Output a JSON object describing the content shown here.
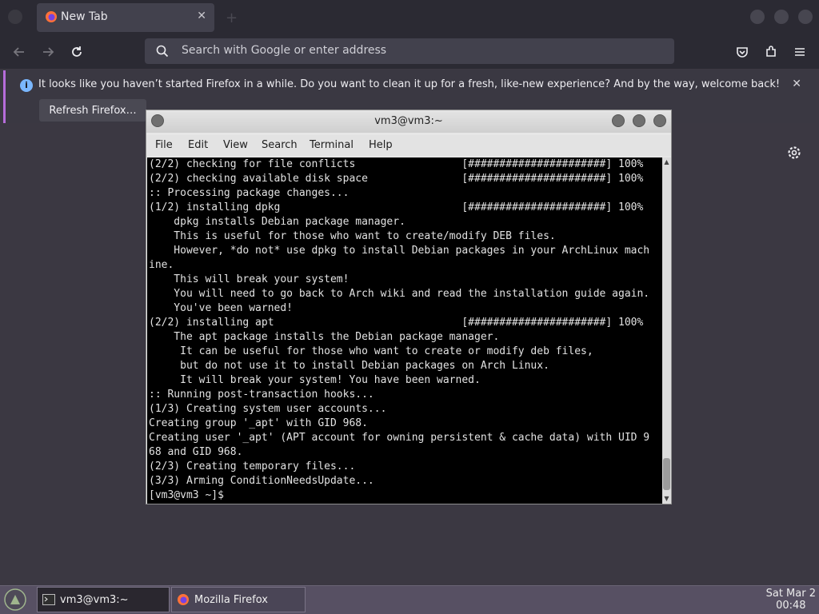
{
  "browser": {
    "tab_title": "New Tab",
    "url_placeholder": "Search with Google or enter address",
    "notification": "It looks like you haven’t started Firefox in a while. Do you want to clean it up for a fresh, like-new experience? And by the way, welcome back!",
    "refresh_label": "Refresh Firefox…"
  },
  "terminal": {
    "title": "vm3@vm3:~",
    "menu": [
      "File",
      "Edit",
      "View",
      "Search",
      "Terminal",
      "Help"
    ],
    "lines": [
      "(2/2) checking for file conflicts                 [######################] 100%",
      "(2/2) checking available disk space               [######################] 100%",
      ":: Processing package changes...",
      "(1/2) installing dpkg                             [######################] 100%",
      "    dpkg installs Debian package manager.",
      "    This is useful for those who want to create/modify DEB files.",
      "    However, *do not* use dpkg to install Debian packages in your ArchLinux mach",
      "ine.",
      "    This will break your system!",
      "    You will need to go back to Arch wiki and read the installation guide again.",
      "    You've been warned!",
      "(2/2) installing apt                              [######################] 100%",
      "    The apt package installs the Debian package manager.",
      "     It can be useful for those who want to create or modify deb files,",
      "     but do not use it to install Debian packages on Arch Linux.",
      "     It will break your system! You have been warned.",
      ":: Running post-transaction hooks...",
      "(1/3) Creating system user accounts...",
      "Creating group '_apt' with GID 968.",
      "Creating user '_apt' (APT account for owning persistent & cache data) with UID 9",
      "68 and GID 968.",
      "(2/3) Creating temporary files...",
      "(3/3) Arming ConditionNeedsUpdate...",
      "[vm3@vm3 ~]$ "
    ]
  },
  "taskbar": {
    "items": [
      "vm3@vm3:~",
      "Mozilla Firefox"
    ],
    "date": "Sat Mar 2",
    "time": "00:48"
  }
}
